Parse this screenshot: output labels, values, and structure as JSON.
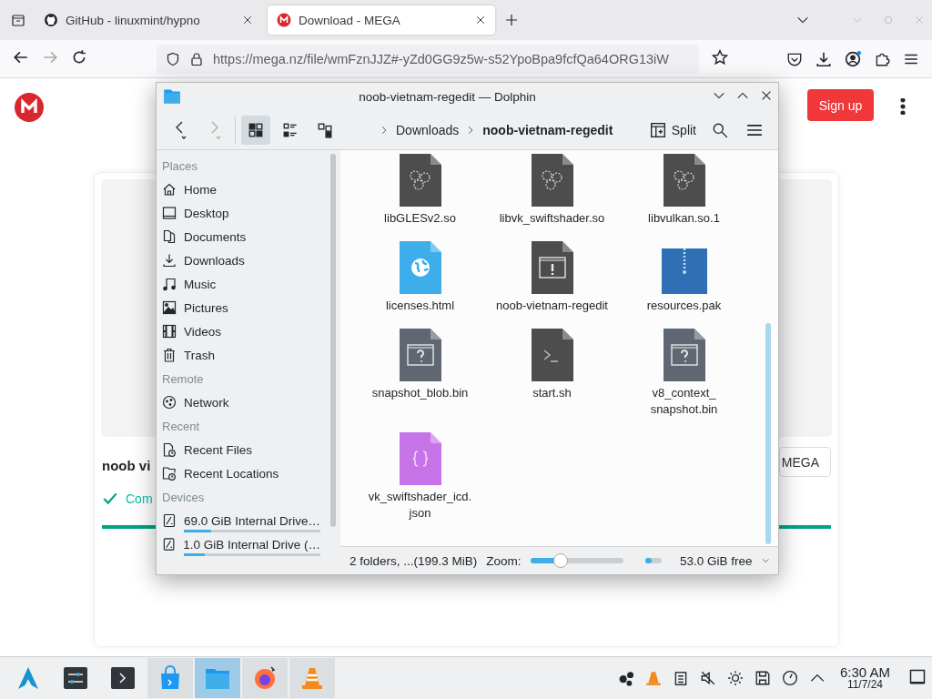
{
  "browser": {
    "tabs": [
      {
        "title": "GitHub - linuxmint/hypno",
        "kind": "github",
        "selected": false
      },
      {
        "title": "Download - MEGA",
        "kind": "mega",
        "selected": true
      }
    ],
    "url": "https://mega.nz/file/wmFznJJZ#-yZd0GG9z5w-s52YpoBpa9fcfQa64ORG13iW"
  },
  "page": {
    "sign_up": "Sign up",
    "file_name": "noob vi",
    "mega_button": "MEGA",
    "status": "Com",
    "progress": {
      "level": 1
    }
  },
  "dolphin": {
    "title": "noob-vietnam-regedit — Dolphin",
    "view_modes": [
      {
        "kind": "icons",
        "selected": true
      },
      {
        "kind": "compact",
        "selected": false
      },
      {
        "kind": "details",
        "selected": false
      }
    ],
    "breadcrumb": [
      {
        "label": "Downloads",
        "current": false
      },
      {
        "label": "noob-vietnam-regedit",
        "current": true
      }
    ],
    "split": "Split",
    "sidebar": [
      {
        "title": "Places",
        "items": [
          {
            "label": "Home",
            "kind": "home"
          },
          {
            "label": "Desktop",
            "kind": "desktop"
          },
          {
            "label": "Documents",
            "kind": "documents"
          },
          {
            "label": "Downloads",
            "kind": "downloads"
          },
          {
            "label": "Music",
            "kind": "music"
          },
          {
            "label": "Pictures",
            "kind": "pictures"
          },
          {
            "label": "Videos",
            "kind": "videos"
          },
          {
            "label": "Trash",
            "kind": "trash"
          }
        ]
      },
      {
        "title": "Remote",
        "items": [
          {
            "label": "Network",
            "kind": "network"
          }
        ]
      },
      {
        "title": "Recent",
        "items": [
          {
            "label": "Recent Files",
            "kind": "recent-files"
          },
          {
            "label": "Recent Locations",
            "kind": "recent-locations"
          }
        ]
      },
      {
        "title": "Devices",
        "items": [
          {
            "label": "69.0 GiB Internal Drive…",
            "kind": "drive",
            "level": 0.2
          },
          {
            "label": "1.0 GiB Internal Drive (…",
            "kind": "drive",
            "level": 0.15
          }
        ]
      }
    ],
    "files": [
      {
        "name": "libGLESv2.so",
        "kind": "library"
      },
      {
        "name": "libvk_swiftshader.so",
        "kind": "library"
      },
      {
        "name": "libvulkan.so.1",
        "kind": "library"
      },
      {
        "name": "licenses.html",
        "kind": "html"
      },
      {
        "name": "noob-vietnam-regedit",
        "kind": "executable"
      },
      {
        "name": "resources.pak",
        "kind": "archive"
      },
      {
        "name": "snapshot_blob.bin",
        "kind": "unknown"
      },
      {
        "name": "start.sh",
        "kind": "script"
      },
      {
        "name": "v8_context_ snapshot.bin",
        "kind": "unknown"
      },
      {
        "name": "vk_swiftshader_icd. json",
        "kind": "json"
      }
    ],
    "status": {
      "summary": "2 folders, ...(199.3 MiB)",
      "zoom_label": "Zoom:",
      "zoom": {
        "level": 0.3
      },
      "space": {
        "level": 0.4
      },
      "free_space": "53.0 GiB free"
    }
  },
  "taskbar": {
    "apps": [
      {
        "kind": "launcher",
        "running": false,
        "selected": false
      },
      {
        "kind": "settings",
        "running": false,
        "selected": false
      },
      {
        "kind": "terminal",
        "running": false,
        "selected": false
      },
      {
        "kind": "store",
        "running": true,
        "selected": false
      },
      {
        "kind": "files",
        "running": true,
        "selected": true
      },
      {
        "kind": "firefox",
        "running": true,
        "selected": false
      },
      {
        "kind": "vlc",
        "running": true,
        "selected": false
      }
    ],
    "time": "6:30 AM",
    "date": "11/7/24"
  }
}
